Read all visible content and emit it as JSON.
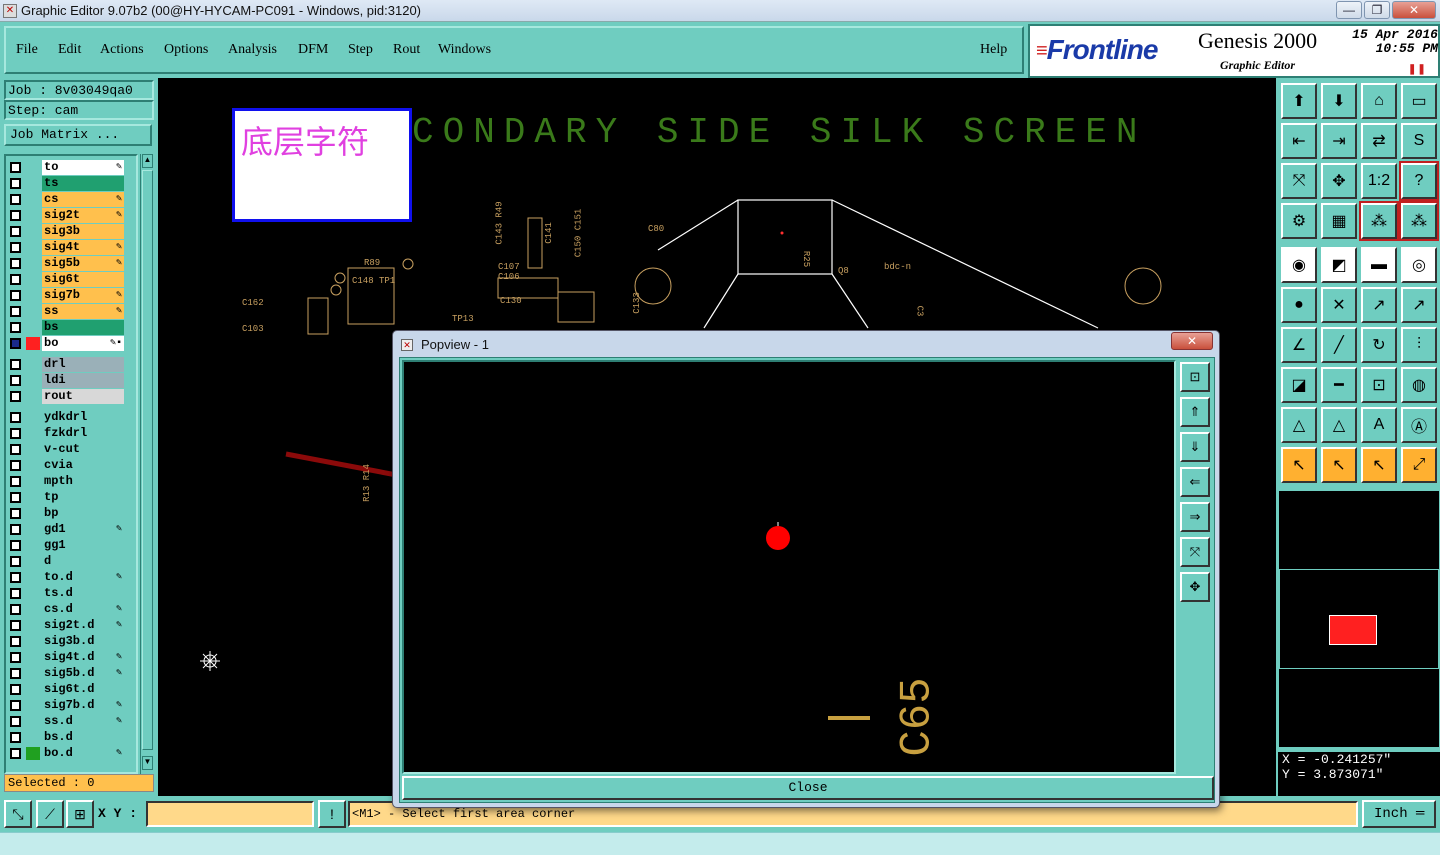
{
  "window": {
    "title": "Graphic Editor 9.07b2 (00@HY-HYCAM-PC091 - Windows, pid:3120)",
    "minimize": "—",
    "maximize": "❐",
    "close": "✕"
  },
  "menu": {
    "items": [
      "File",
      "Edit",
      "Actions",
      "Options",
      "Analysis",
      "DFM",
      "Step",
      "Rout",
      "Windows"
    ],
    "help": "Help"
  },
  "brand": {
    "logo": "Frontline",
    "product": "Genesis 2000",
    "subtitle": "Graphic Editor",
    "date": "15 Apr 2016",
    "time": "10:55 PM"
  },
  "job": {
    "job_label": "Job : 8v03049qa0",
    "step_label": "Step: cam",
    "matrix_button": "Job Matrix ..."
  },
  "layers": [
    {
      "name": "to",
      "color": "#ffffff",
      "mark": "✎"
    },
    {
      "name": "ts",
      "color": "#20a070",
      "mark": ""
    },
    {
      "name": "cs",
      "color": "#ffc04d",
      "mark": "✎"
    },
    {
      "name": "sig2t",
      "color": "#ffc04d",
      "mark": "✎"
    },
    {
      "name": "sig3b",
      "color": "#ffc04d",
      "mark": ""
    },
    {
      "name": "sig4t",
      "color": "#ffc04d",
      "mark": "✎"
    },
    {
      "name": "sig5b",
      "color": "#ffc04d",
      "mark": "✎"
    },
    {
      "name": "sig6t",
      "color": "#ffc04d",
      "mark": ""
    },
    {
      "name": "sig7b",
      "color": "#ffc04d",
      "mark": "✎"
    },
    {
      "name": "ss",
      "color": "#ffc04d",
      "mark": "✎"
    },
    {
      "name": "bs",
      "color": "#20a070",
      "mark": ""
    },
    {
      "name": "bo",
      "color": "#ffffff",
      "mark": "✎▪",
      "active": true
    },
    {
      "name": "drl",
      "color": "#9ab0b8",
      "mark": "",
      "gap": true
    },
    {
      "name": "ldi",
      "color": "#9ab0b8",
      "mark": ""
    },
    {
      "name": "rout",
      "color": "#d8d8d8",
      "mark": ""
    },
    {
      "name": "ydkdrl",
      "color": "#6fcdc0",
      "mark": "",
      "gap": true
    },
    {
      "name": "fzkdrl",
      "color": "#6fcdc0",
      "mark": ""
    },
    {
      "name": "v-cut",
      "color": "#6fcdc0",
      "mark": ""
    },
    {
      "name": "cvia",
      "color": "#6fcdc0",
      "mark": ""
    },
    {
      "name": "mpth",
      "color": "#6fcdc0",
      "mark": ""
    },
    {
      "name": "tp",
      "color": "#6fcdc0",
      "mark": ""
    },
    {
      "name": "bp",
      "color": "#6fcdc0",
      "mark": ""
    },
    {
      "name": "gd1",
      "color": "#6fcdc0",
      "mark": "✎"
    },
    {
      "name": "gg1",
      "color": "#6fcdc0",
      "mark": ""
    },
    {
      "name": "d",
      "color": "#6fcdc0",
      "mark": ""
    },
    {
      "name": "to.d",
      "color": "#6fcdc0",
      "mark": "✎"
    },
    {
      "name": "ts.d",
      "color": "#6fcdc0",
      "mark": ""
    },
    {
      "name": "cs.d",
      "color": "#6fcdc0",
      "mark": "✎"
    },
    {
      "name": "sig2t.d",
      "color": "#6fcdc0",
      "mark": "✎"
    },
    {
      "name": "sig3b.d",
      "color": "#6fcdc0",
      "mark": ""
    },
    {
      "name": "sig4t.d",
      "color": "#6fcdc0",
      "mark": "✎"
    },
    {
      "name": "sig5b.d",
      "color": "#6fcdc0",
      "mark": "✎"
    },
    {
      "name": "sig6t.d",
      "color": "#6fcdc0",
      "mark": ""
    },
    {
      "name": "sig7b.d",
      "color": "#6fcdc0",
      "mark": "✎"
    },
    {
      "name": "ss.d",
      "color": "#6fcdc0",
      "mark": "✎"
    },
    {
      "name": "bs.d",
      "color": "#6fcdc0",
      "mark": ""
    },
    {
      "name": "bo.d",
      "color": "#6fcdc0",
      "mark": "✎",
      "swatch": "#20a020"
    }
  ],
  "selected": "Selected : 0",
  "canvas": {
    "note": "底层字符",
    "silk_title": "CONDARY SIDE SILK SCREEN"
  },
  "popview": {
    "title": "Popview - 1",
    "close_label": "Close",
    "silk_label": "C65"
  },
  "coords": {
    "x": "X = -0.241257\"",
    "y": "Y = 3.873071\""
  },
  "bottom": {
    "xy_label": "X Y :",
    "xy_value": "",
    "prompt": "<M1> - Select first area corner",
    "unit": "Inch"
  },
  "colors": {
    "panel": "#6fcdc0",
    "highlight": "#ff0000",
    "arrow": "#8b0a0a",
    "silk": "#c8a040"
  }
}
